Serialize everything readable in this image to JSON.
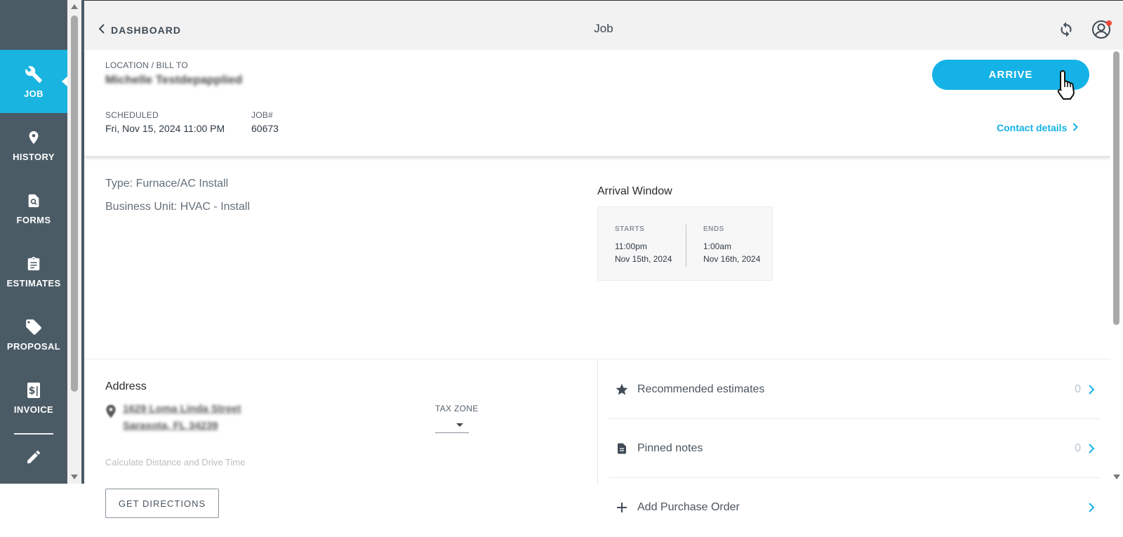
{
  "sidebar": {
    "items": [
      {
        "label": "JOB",
        "icon": "wrench-icon",
        "active": true
      },
      {
        "label": "HISTORY",
        "icon": "location-pin-icon",
        "active": false
      },
      {
        "label": "FORMS",
        "icon": "form-search-icon",
        "active": false
      },
      {
        "label": "ESTIMATES",
        "icon": "clipboard-icon",
        "active": false
      },
      {
        "label": "PROPOSAL",
        "icon": "tag-icon",
        "active": false
      },
      {
        "label": "INVOICE",
        "icon": "invoice-dollar-icon",
        "active": false
      }
    ],
    "extra_icon": "pencil-icon"
  },
  "header": {
    "back_label": "DASHBOARD",
    "title": "Job"
  },
  "job": {
    "location_label": "LOCATION / BILL TO",
    "location_name": "Michelle Testdepapplied",
    "scheduled_label": "SCHEDULED",
    "scheduled_value": "Fri, Nov 15, 2024 11:00 PM",
    "job_label": "JOB#",
    "job_value": "60673",
    "arrive_label": "ARRIVE",
    "contact_label": "Contact details"
  },
  "info": {
    "type_line": "Type: Furnace/AC Install",
    "business_unit_line": "Business Unit: HVAC - Install"
  },
  "arrival_window": {
    "title": "Arrival Window",
    "starts_label": "STARTS",
    "starts_time": "11:00pm",
    "starts_date": "Nov 15th, 2024",
    "ends_label": "ENDS",
    "ends_time": "1:00am",
    "ends_date": "Nov 16th, 2024"
  },
  "address": {
    "title": "Address",
    "line1": "1629 Loma Linda Street",
    "line2": "Sarasota, FL 34239",
    "tax_zone_label": "TAX ZONE",
    "calc_label": "Calculate Distance and Drive Time",
    "directions_label": "GET DIRECTIONS"
  },
  "links": [
    {
      "label": "Recommended estimates",
      "count": "0",
      "icon": "star-icon"
    },
    {
      "label": "Pinned notes",
      "count": "0",
      "icon": "document-icon"
    },
    {
      "label": "Add Purchase Order",
      "count": "",
      "icon": "plus-icon"
    }
  ],
  "colors": {
    "sidebar": "#4b5b66",
    "accent": "#14b2e6",
    "notification": "#f04a37"
  }
}
